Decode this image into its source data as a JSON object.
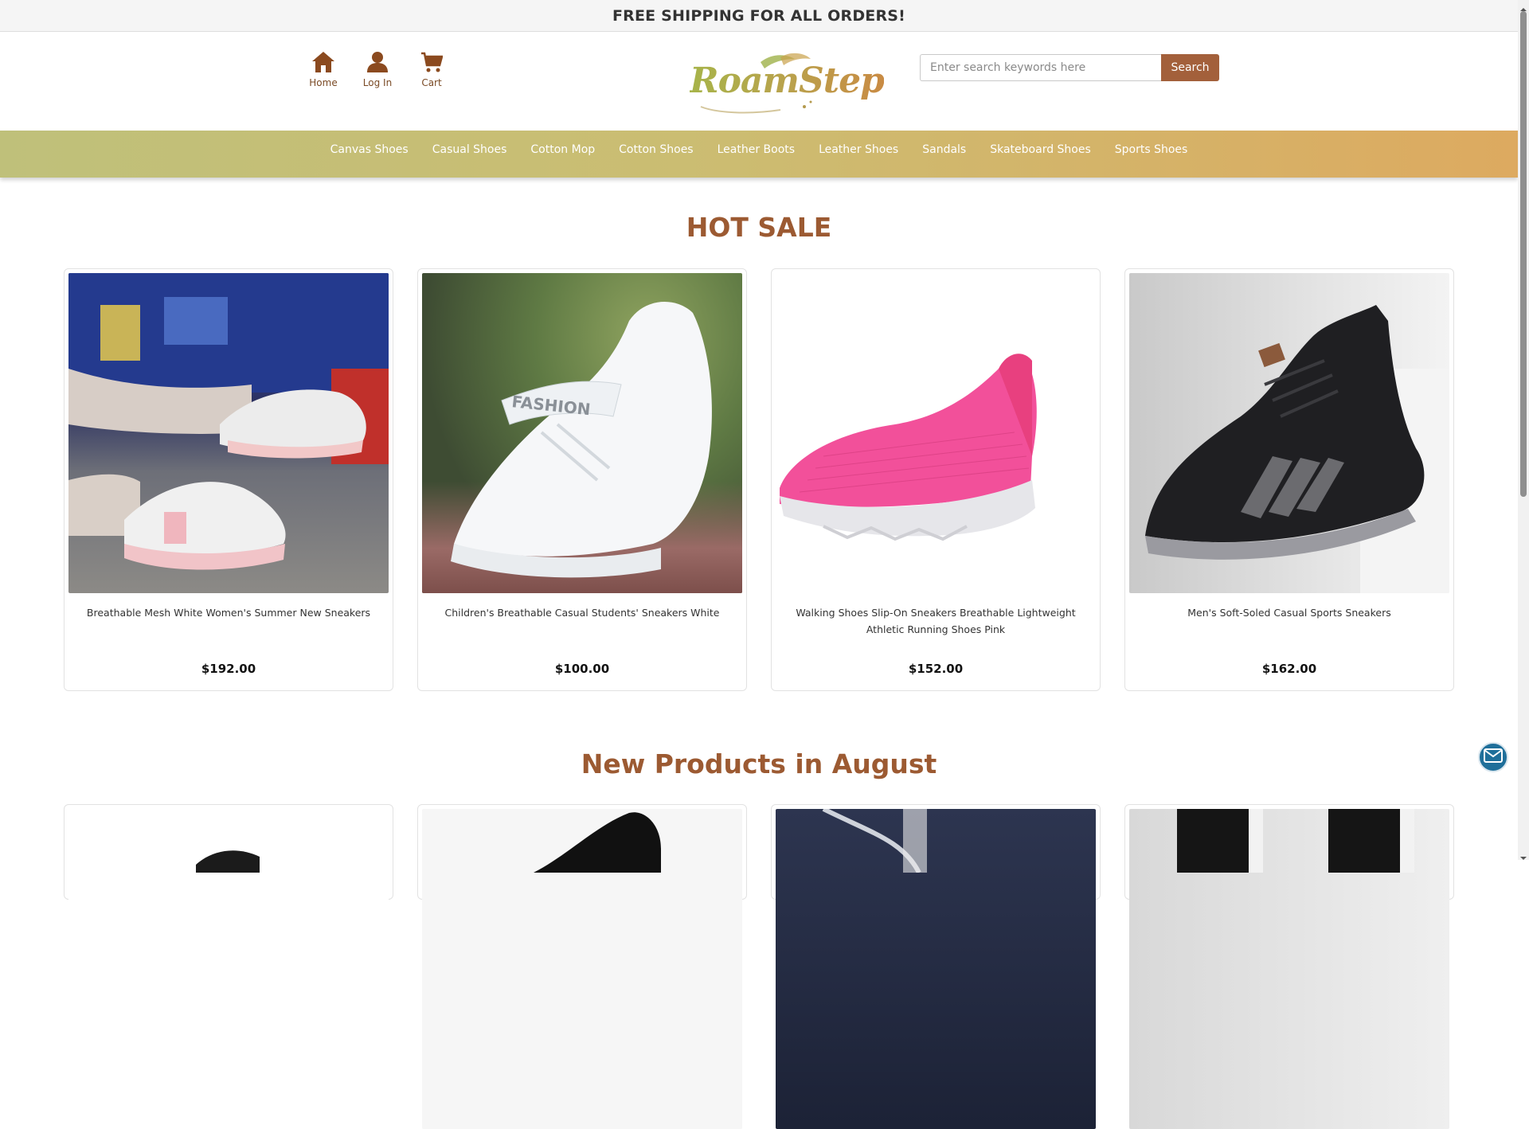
{
  "banner": {
    "text": "FREE SHIPPING FOR ALL ORDERS!"
  },
  "header": {
    "nav": [
      {
        "label": "Home",
        "icon": "home-icon"
      },
      {
        "label": "Log In",
        "icon": "user-icon"
      },
      {
        "label": "Cart",
        "icon": "cart-icon"
      }
    ],
    "logo_text": "RoamStep",
    "search": {
      "placeholder": "Enter search keywords here",
      "button_label": "Search"
    }
  },
  "categories": [
    "Canvas Shoes",
    "Casual Shoes",
    "Cotton Mop",
    "Cotton Shoes",
    "Leather Boots",
    "Leather Shoes",
    "Sandals",
    "Skateboard Shoes",
    "Sports Shoes"
  ],
  "hot_sale": {
    "title": "HOT SALE",
    "products": [
      {
        "name": "Breathable Mesh White Women's Summer New Sneakers",
        "price": "$192.00"
      },
      {
        "name": "Children's Breathable Casual Students' Sneakers White",
        "price": "$100.00"
      },
      {
        "name": "Walking Shoes Slip-On Sneakers Breathable Lightweight Athletic Running Shoes Pink",
        "price": "$152.00"
      },
      {
        "name": "Men's Soft-Soled Casual Sports Sneakers",
        "price": "$162.00"
      }
    ]
  },
  "new_products": {
    "title": "New Products in August"
  },
  "colors": {
    "accent": "#9c5a32",
    "button": "#a3603b",
    "nav_start": "#bfc07a",
    "nav_end": "#ddaa60",
    "mail": "#1f6f9a"
  }
}
